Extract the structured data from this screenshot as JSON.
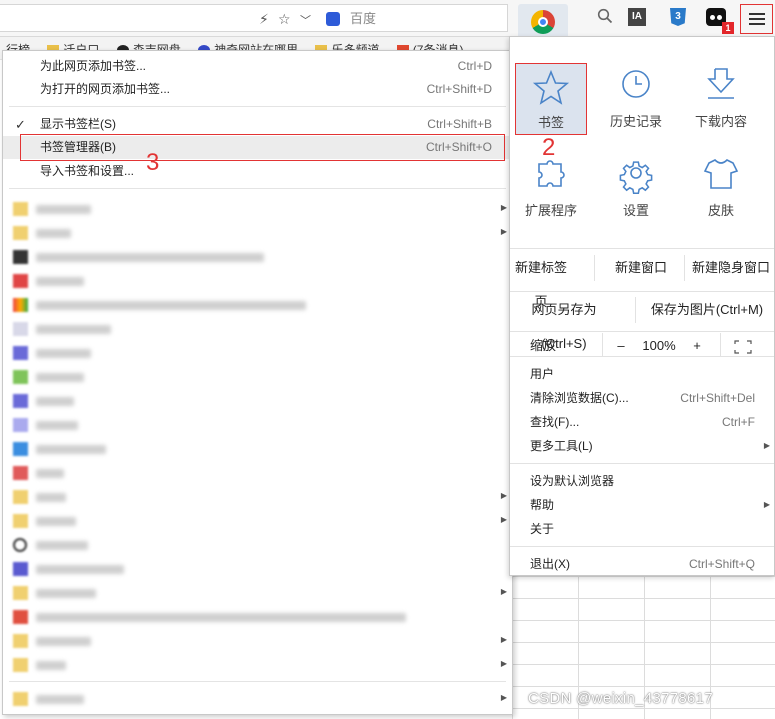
{
  "toolbar": {
    "search_engine": "百度",
    "chrome_badge_count": "1",
    "ia_label": "IA",
    "css3_label": "3"
  },
  "bookmarks_bar": {
    "items": [
      "行榜",
      "迁户口",
      "森吉网盘",
      "神奇网站在哪里",
      "乐多频道",
      "(7条消息)"
    ]
  },
  "bookmark_menu": {
    "add_page": {
      "label": "为此网页添加书签...",
      "shortcut": "Ctrl+D"
    },
    "add_open_pages": {
      "label": "为打开的网页添加书签...",
      "shortcut": "Ctrl+Shift+D"
    },
    "show_bar": {
      "label": "显示书签栏(S)",
      "shortcut": "Ctrl+Shift+B",
      "checked": "✓"
    },
    "manager": {
      "label": "书签管理器(B)",
      "shortcut": "Ctrl+Shift+O"
    },
    "import": {
      "label": "导入书签和设置..."
    },
    "annotation": "3"
  },
  "main_menu": {
    "tiles": [
      {
        "label": "书签",
        "icon": "star-icon"
      },
      {
        "label": "历史记录",
        "icon": "clock-icon"
      },
      {
        "label": "下载内容",
        "icon": "download-icon"
      },
      {
        "label": "扩展程序",
        "icon": "puzzle-icon"
      },
      {
        "label": "设置",
        "icon": "gear-icon"
      },
      {
        "label": "皮肤",
        "icon": "shirt-icon"
      }
    ],
    "new_tab": "新建标签页",
    "new_window": "新建窗口",
    "new_incognito": "新建隐身窗口",
    "save_page": "网页另存为(Ctrl+S)",
    "save_image": "保存为图片(Ctrl+M)",
    "zoom_label": "缩放",
    "zoom_minus": "–",
    "zoom_value": "100%",
    "zoom_plus": "+",
    "user": "用户",
    "clear_data": {
      "label": "清除浏览数据(C)...",
      "shortcut": "Ctrl+Shift+Del"
    },
    "find": {
      "label": "查找(F)...",
      "shortcut": "Ctrl+F"
    },
    "more_tools": {
      "label": "更多工具(L)"
    },
    "default_browser": "设为默认浏览器",
    "help": "帮助",
    "about": "关于",
    "exit": {
      "label": "退出(X)",
      "shortcut": "Ctrl+Shift+Q"
    }
  },
  "annotations": {
    "one": "1",
    "two": "2"
  },
  "watermark": "CSDN @weixin_43778617",
  "colors": {
    "highlight_box": "#e23434",
    "active_tile_bg": "#dbe3ee"
  }
}
